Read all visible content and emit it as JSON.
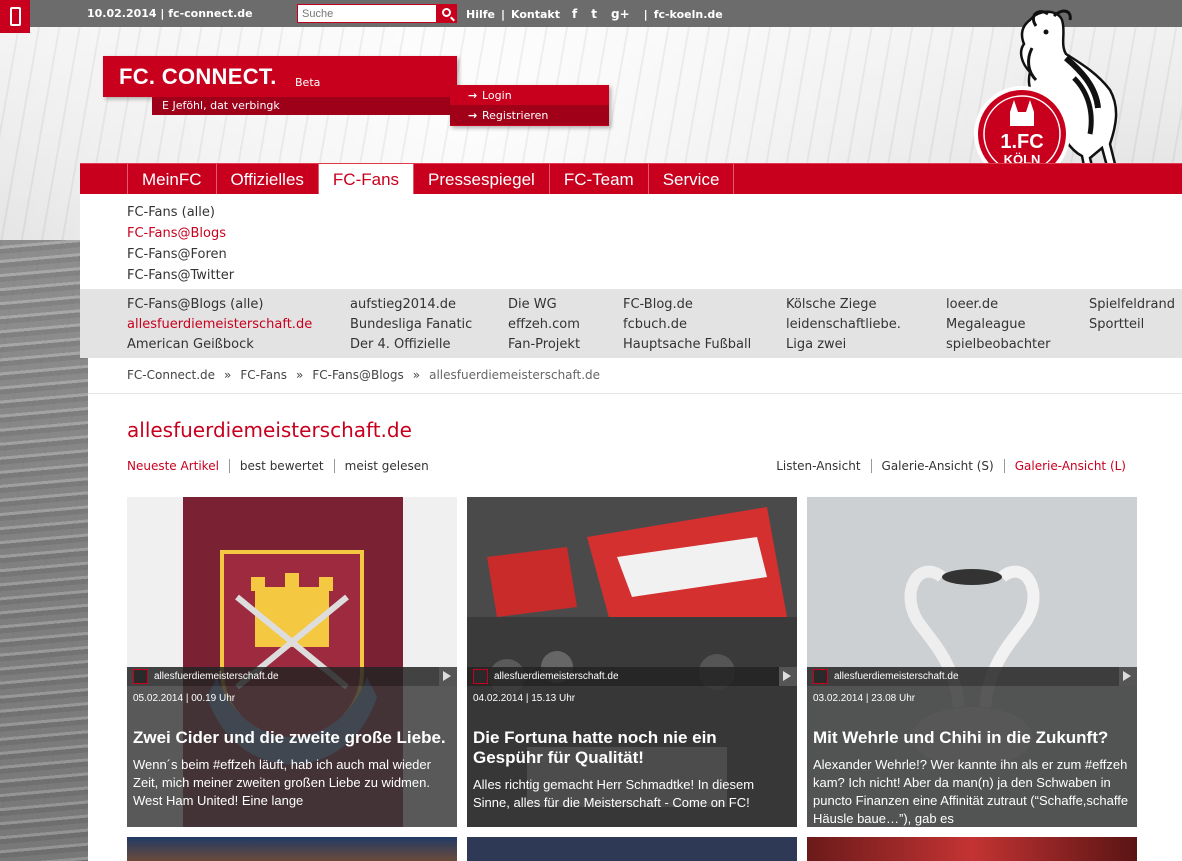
{
  "topbar": {
    "date_site": "10.02.2014 | fc-connect.de",
    "search_placeholder": "Suche",
    "links": [
      "Hilfe",
      "Kontakt"
    ],
    "social": [
      "f",
      "t",
      "g+"
    ],
    "koeln_link": "fc-koeln.de"
  },
  "brand": {
    "name": "FC. CONNECT.",
    "beta": "Beta",
    "motto": "E Jeföhl, dat verbingk"
  },
  "auth": {
    "login": "Login",
    "register": "Registrieren"
  },
  "crest": {
    "text_top": "1.FC",
    "text_bottom": "KÖLN"
  },
  "nav": {
    "items": [
      "MeinFC",
      "Offizielles",
      "FC-Fans",
      "Pressespiegel",
      "FC-Team",
      "Service"
    ],
    "active": "FC-Fans"
  },
  "subnav": {
    "items": [
      "FC-Fans (alle)",
      "FC-Fans@Blogs",
      "FC-Fans@Foren",
      "FC-Fans@Twitter"
    ],
    "active": "FC-Fans@Blogs"
  },
  "blogs": {
    "columns": [
      [
        "FC-Fans@Blogs (alle)",
        "allesfuerdiemeisterschaft.de",
        "American Geißbock"
      ],
      [
        "aufstieg2014.de",
        "Bundesliga Fanatic",
        "Der 4. Offizielle"
      ],
      [
        "Die WG",
        "effzeh.com",
        "Fan-Projekt"
      ],
      [
        "FC-Blog.de",
        "fcbuch.de",
        "Hauptsache Fußball"
      ],
      [
        "Kölsche Ziege",
        "leidenschaftliebe.",
        "Liga zwei"
      ],
      [
        "loeer.de",
        "Megaleague",
        "spielbeobachter"
      ],
      [
        "Spielfeldrand",
        "Sportteil"
      ]
    ],
    "active": "allesfuerdiemeisterschaft.de"
  },
  "breadcrumb": {
    "items": [
      "FC-Connect.de",
      "FC-Fans",
      "FC-Fans@Blogs",
      "allesfuerdiemeisterschaft.de"
    ],
    "separator": "»"
  },
  "page": {
    "title": "allesfuerdiemeisterschaft.de"
  },
  "sort": {
    "items": [
      "Neueste Artikel",
      "best bewertet",
      "meist gelesen"
    ],
    "active": "Neueste Artikel"
  },
  "views": {
    "items": [
      "Listen-Ansicht",
      "Galerie-Ansicht (S)",
      "Galerie-Ansicht (L)"
    ],
    "active": "Galerie-Ansicht (L)"
  },
  "cards": [
    {
      "source": "allesfuerdiemeisterschaft.de",
      "date": "05.02.2014 | 00.19 Uhr",
      "title": "Zwei Cider und die zweite große Liebe.",
      "excerpt": "Wenn´s beim #effzeh läuft, hab ich auch mal wieder Zeit, mich meiner zweiten großen Liebe zu widmen. West Ham United! Eine lange"
    },
    {
      "source": "allesfuerdiemeisterschaft.de",
      "date": "04.02.2014 | 15.13 Uhr",
      "title": "Die Fortuna hatte noch nie ein Gespühr für Qualität!",
      "excerpt": "Alles richtig gemacht Herr Schmadtke! In diesem Sinne, alles für die Meisterschaft - Come on FC!"
    },
    {
      "source": "allesfuerdiemeisterschaft.de",
      "date": "03.02.2014 | 23.08 Uhr",
      "title": "Mit Wehrle und Chihi in die Zukunft?",
      "excerpt": "Alexander Wehrle!? Wer kannte ihn als er zum #effzeh kam? Ich nicht! Aber da man(n) ja den Schwaben in puncto Finanzen eine Affinität zutraut (“Schaffe,schaffe Häusle baue…”), gab es"
    }
  ],
  "colors": {
    "brand_red": "#c8001e",
    "dark_red": "#9e0019",
    "topbar": "#6c6c6c"
  }
}
